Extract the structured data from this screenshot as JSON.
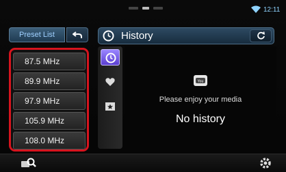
{
  "status": {
    "clock": "12:11"
  },
  "preset_panel": {
    "tab_label": "Preset List",
    "items": [
      {
        "label": "87.5 MHz"
      },
      {
        "label": "89.9 MHz"
      },
      {
        "label": "97.9 MHz"
      },
      {
        "label": "105.9 MHz"
      },
      {
        "label": "108.0 MHz"
      }
    ]
  },
  "history_panel": {
    "title": "History",
    "message": "Please enjoy your media",
    "empty_text": "No history"
  },
  "icons": {
    "history": "clock-icon",
    "favorite": "heart-icon",
    "bookmark": "star-icon",
    "media": "youtube-icon",
    "back": "back-arrow-icon",
    "refresh": "refresh-icon",
    "search": "search-icon",
    "settings": "gear-icon"
  },
  "colors": {
    "highlight_border": "#d6141e",
    "active_button": "#7a62f0",
    "clock": "#8fd3ff"
  }
}
